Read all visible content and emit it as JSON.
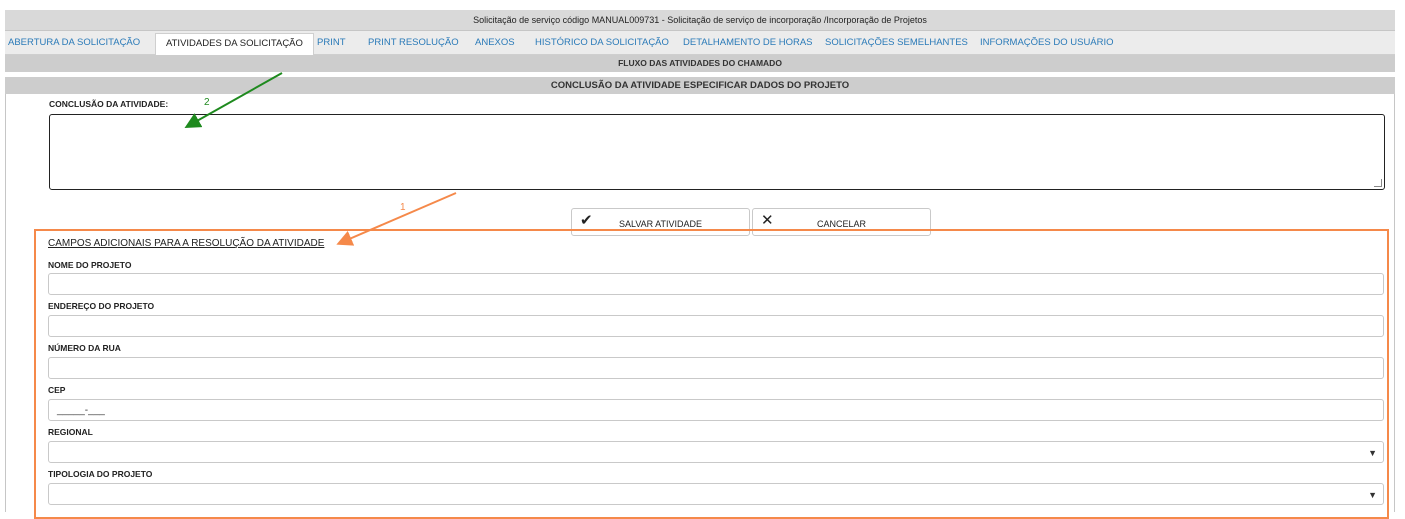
{
  "window": {
    "title": "Solicitação de serviço código MANUAL009731 - Solicitação de serviço de incorporação /Incorporação de Projetos"
  },
  "tabs": [
    {
      "label": "ABERTURA DA SOLICITAÇÃO",
      "active": false
    },
    {
      "label": "ATIVIDADES DA SOLICITAÇÃO",
      "active": true
    },
    {
      "label": "PRINT",
      "active": false
    },
    {
      "label": "PRINT RESOLUÇÃO",
      "active": false
    },
    {
      "label": "ANEXOS",
      "active": false
    },
    {
      "label": "HISTÓRICO DA SOLICITAÇÃO",
      "active": false
    },
    {
      "label": "DETALHAMENTO DE HORAS",
      "active": false
    },
    {
      "label": "SOLICITAÇÕES SEMELHANTES",
      "active": false
    },
    {
      "label": "INFORMAÇÕES DO USUÁRIO",
      "active": false
    }
  ],
  "sections": {
    "flow": "FLUXO DAS ATIVIDADES DO CHAMADO",
    "conclusion": "CONCLUSÃO DA ATIVIDADE ESPECIFICAR DADOS DO PROJETO"
  },
  "form": {
    "conclusion_label": "CONCLUSÃO DA ATIVIDADE:",
    "conclusion_value": "",
    "save_button": "SALVAR ATIVIDADE",
    "cancel_button": "CANCELAR",
    "additional_heading": "CAMPOS ADICIONAIS PARA A RESOLUÇÃO DA ATIVIDADE",
    "fields": {
      "project_name": {
        "label": "NOME DO PROJETO",
        "value": ""
      },
      "project_address": {
        "label": "ENDEREÇO DO PROJETO",
        "value": ""
      },
      "street_number": {
        "label": "NÚMERO DA RUA",
        "value": ""
      },
      "cep": {
        "label": "CEP",
        "value": "_____-___"
      },
      "regional": {
        "label": "REGIONAL",
        "value": ""
      },
      "project_type": {
        "label": "TIPOLOGIA DO PROJETO",
        "value": ""
      }
    },
    "select_arrow": "▼"
  },
  "annotations": {
    "marker_1": "1",
    "marker_2": "2",
    "orange_color": "#f5894a",
    "green_color": "#1e8a1e"
  },
  "icons": {
    "save": "✔",
    "cancel": "✕"
  }
}
